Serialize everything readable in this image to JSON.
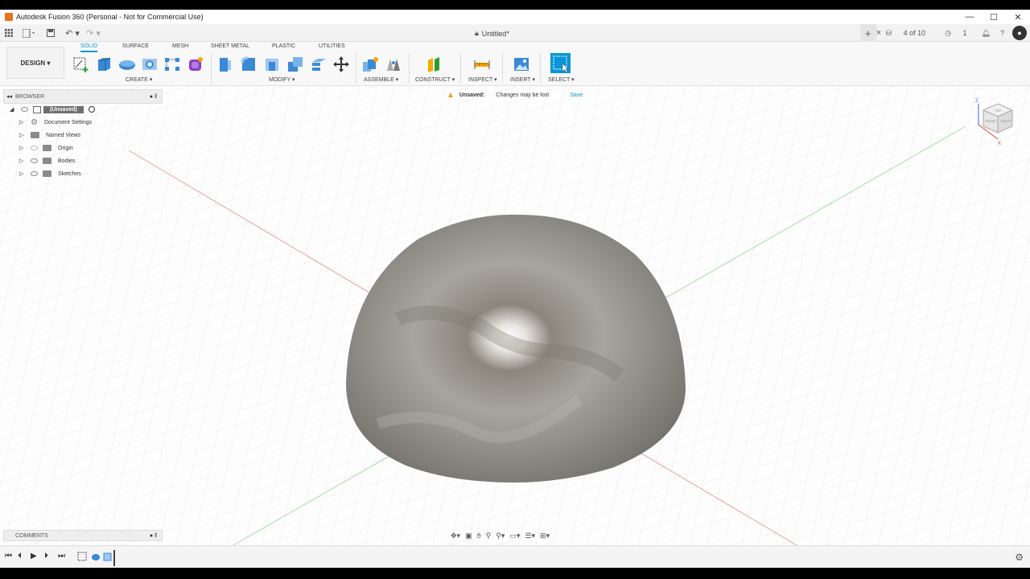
{
  "window": {
    "title": "Autodesk Fusion 360 (Personal - Not for Commercial Use)",
    "controls": [
      "—",
      "☐",
      "✕"
    ]
  },
  "appbar": {
    "doc_title": "Untitled*",
    "close": "×",
    "add": "+",
    "jobs": "4 of 10",
    "clock_count": "1"
  },
  "ribbon": {
    "workspace": "DESIGN ▾",
    "tabs": [
      "SOLID",
      "SURFACE",
      "MESH",
      "SHEET METAL",
      "PLASTIC",
      "UTILITIES"
    ],
    "groups": {
      "create": "CREATE ▾",
      "modify": "MODIFY ▾",
      "assemble": "ASSEMBLE ▾",
      "construct": "CONSTRUCT ▾",
      "inspect": "INSPECT ▾",
      "insert": "INSERT ▾",
      "select": "SELECT ▾"
    }
  },
  "browser": {
    "label": "BROWSER",
    "root": "(Unsaved)",
    "items": [
      {
        "label": "Document Settings",
        "icon": "gear-icon"
      },
      {
        "label": "Named Views",
        "icon": "folder-icon"
      },
      {
        "label": "Origin",
        "icon": "folder-icon"
      },
      {
        "label": "Bodies",
        "icon": "folder-icon"
      },
      {
        "label": "Sketches",
        "icon": "folder-icon"
      }
    ]
  },
  "notice": {
    "title": "Unsaved:",
    "message": "Changes may be lost",
    "action": "Save"
  },
  "viewcube": {
    "faces": [
      "TOP",
      "FRONT",
      "RIGHT"
    ],
    "axes": [
      "Z",
      "X"
    ]
  },
  "comments": {
    "label": "COMMENTS"
  },
  "colors": {
    "accent": "#0696d7",
    "warning": "#e8a21d",
    "body": "#8a8880"
  }
}
